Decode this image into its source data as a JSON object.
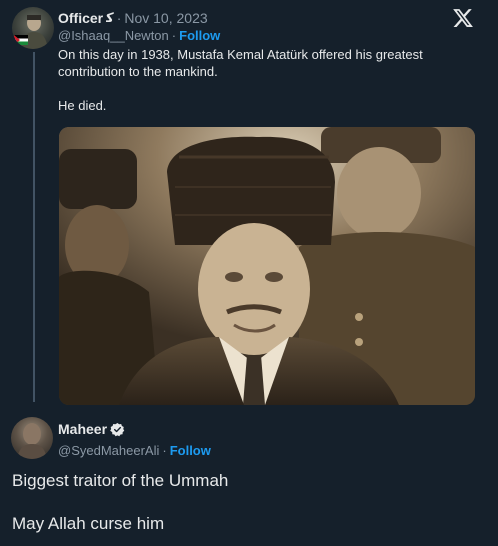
{
  "parent_tweet": {
    "display_name": "Officer",
    "name_suffix": "ﮐ",
    "separator": "·",
    "date": "Nov 10, 2023",
    "handle": "@Ishaaq__Newton",
    "follow_label": "Follow",
    "text_line1": "On this day in 1938, Mustafa Kemal Atatürk offered his greatest contribution to the mankind.",
    "text_line2": "He died.",
    "photo_icon": "historical-photo"
  },
  "brand": {
    "logo": "x-logo-icon"
  },
  "reply": {
    "display_name": "Maheer",
    "separator": "·",
    "handle": "@SyedMaheerAli",
    "follow_label": "Follow",
    "text_line1": "Biggest traitor of the Ummah",
    "text_line2": "May Allah curse him"
  },
  "colors": {
    "background": "#15202b",
    "text_primary": "#e7e9ea",
    "text_secondary": "#8b98a5",
    "accent": "#1d9bf0",
    "thread_line": "#425364"
  }
}
